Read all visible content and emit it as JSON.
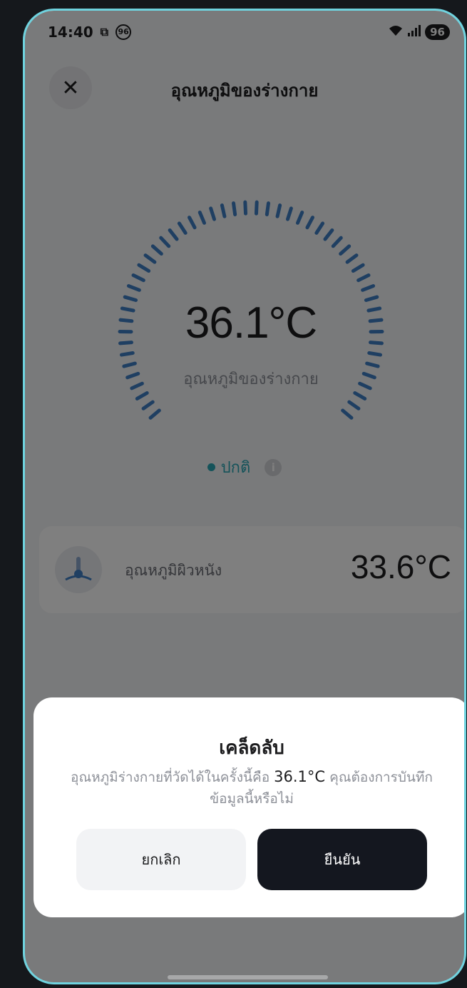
{
  "status_bar": {
    "time": "14:40",
    "notification_badge": "96",
    "battery": "96"
  },
  "header": {
    "title": "อุณหภูมิของร่างกาย"
  },
  "gauge": {
    "value": "36.1°C",
    "label": "อุณหภูมิของร่างกาย",
    "status": "ปกติ"
  },
  "skin_card": {
    "label": "อุณหภูมิผิวหนัง",
    "value": "33.6°C"
  },
  "dialog": {
    "title": "เคล็ดลับ",
    "message_prefix": "อุณหภูมิร่างกายที่วัดได้ในครั้งนี้คือ ",
    "message_value": "36.1°C",
    "message_suffix": " คุณต้องการบันทึกข้อมูลนี้หรือไม่",
    "cancel_label": "ยกเลิก",
    "confirm_label": "ยืนยัน"
  },
  "colors": {
    "accent": "#2aa7b5",
    "gauge_tick": "#3f7fc4",
    "confirm_button": "#14171f",
    "frame_border": "#6fd3df"
  }
}
